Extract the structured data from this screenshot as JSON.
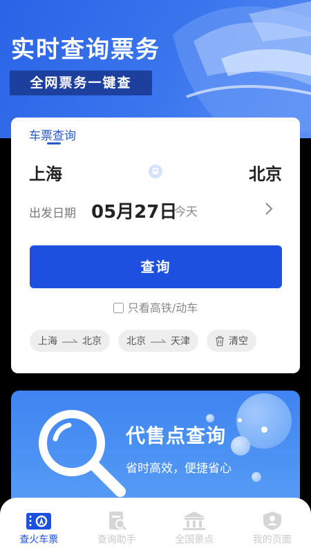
{
  "hero": {
    "title": "实时查询票务",
    "badge": "全网票务一键查"
  },
  "search_card": {
    "tab_label": "车票查询",
    "from_city": "上海",
    "to_city": "北京",
    "date_label": "出发日期",
    "date_value": "05月27日",
    "date_relative": "今天",
    "search_button": "查询",
    "hsr_only_label": "只看高铁/动车",
    "history": [
      {
        "from": "上海",
        "to": "北京"
      },
      {
        "from": "北京",
        "to": "天津"
      }
    ],
    "clear_label": "清空"
  },
  "agent_banner": {
    "title": "代售点查询",
    "subtitle": "省时高效，便捷省心"
  },
  "tabbar": {
    "items": [
      {
        "label": "查火车票",
        "icon": "train-ticket-icon",
        "active": true
      },
      {
        "label": "查询助手",
        "icon": "assistant-icon",
        "active": false
      },
      {
        "label": "全国景点",
        "icon": "landmark-icon",
        "active": false
      },
      {
        "label": "我的页面",
        "icon": "profile-icon",
        "active": false
      }
    ]
  },
  "colors": {
    "primary": "#1e50df",
    "hero_bg": "#3b76ee",
    "badge_bg": "#1d3f9e",
    "inactive_tab": "#c9c9c9"
  }
}
